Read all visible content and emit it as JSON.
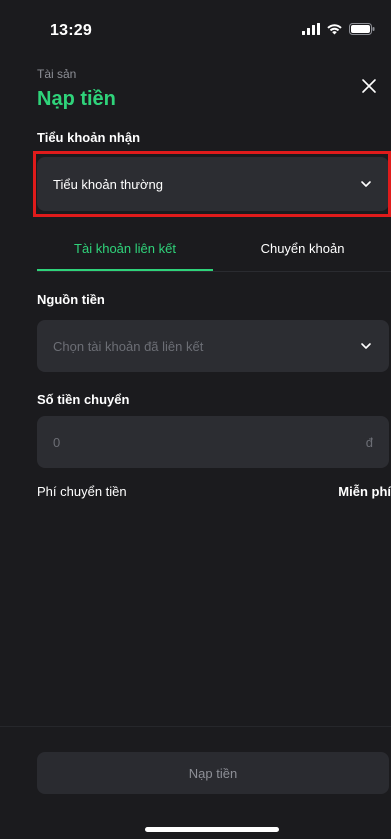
{
  "status_bar": {
    "time": "13:29"
  },
  "header": {
    "breadcrumb": "Tài sản",
    "title": "Nạp tiền"
  },
  "receive_account": {
    "label": "Tiểu khoản nhận",
    "selected": "Tiểu khoản thường"
  },
  "tabs": [
    {
      "label": "Tài khoản liên kết",
      "active": true
    },
    {
      "label": "Chuyển khoản",
      "active": false
    }
  ],
  "source": {
    "label": "Nguồn tiền",
    "placeholder": "Chọn tài khoản đã liên kết"
  },
  "amount": {
    "label": "Số tiền chuyển",
    "placeholder": "0",
    "currency": "đ"
  },
  "fee": {
    "label": "Phí chuyển tiền",
    "value": "Miễn phí"
  },
  "submit_label": "Nạp tiền",
  "colors": {
    "background": "#1b1b1e",
    "accent": "#2fd37a",
    "field": "#2c2d32",
    "highlight": "#e01b1b"
  }
}
